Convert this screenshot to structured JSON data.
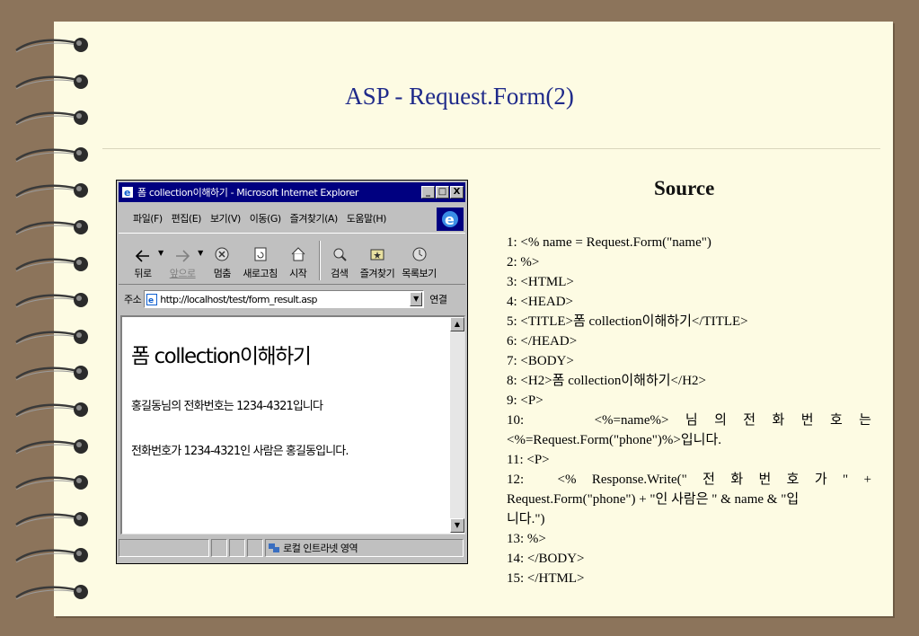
{
  "slide": {
    "title": "ASP - Request.Form(2)",
    "source_heading": "Source"
  },
  "browser": {
    "window_title": "폼 collection이해하기 - Microsoft Internet Explorer",
    "window_buttons": [
      "_",
      "□",
      "X"
    ],
    "menu": [
      "파일(F)",
      "편집(E)",
      "보기(V)",
      "이동(G)",
      "즐겨찾기(A)",
      "도움말(H)"
    ],
    "toolbar": {
      "back": "뒤로",
      "forward": "앞으로",
      "stop": "멈춤",
      "refresh": "새로고침",
      "home": "시작",
      "search": "검색",
      "favorites": "즐겨찾기",
      "history": "목록보기"
    },
    "address_label": "주소",
    "address_url": "http://localhost/test/form_result.asp",
    "go_label": "연결",
    "page": {
      "heading": "폼 collection이해하기",
      "line1": "홍길동님의 전화번호는 1234-4321입니다",
      "line2": "전화번호가 1234-4321인 사람은 홍길동입니다."
    },
    "status_zone": "로컬 인트라넷 영역"
  },
  "source_code": {
    "l1": "1:  <% name = Request.Form(\"name\")",
    "l2": "2:  %>",
    "l3": "3:  <HTML>",
    "l4": "4:  <HEAD>",
    "l5": "5:    <TITLE>폼 collection이해하기</TITLE>",
    "l6": "6:  </HEAD>",
    "l7": "7:  <BODY>",
    "l8": "8:    <H2>폼 collection이해하기</H2>",
    "l9": "9:    <P>",
    "l10_parts": [
      "10:",
      "<%=name%>",
      "님",
      "의",
      "전",
      "화",
      "번",
      "호",
      "는"
    ],
    "l10b": "<%=Request.Form(\"phone\")%>입니다.",
    "l11": "11:   <P>",
    "l12_parts": [
      "12:",
      "<%",
      "Response.Write(\"",
      "전",
      "화",
      "번",
      "호",
      "가",
      "\"",
      "+"
    ],
    "l12b": "Request.Form(\"phone\") + \"인 사람은 \" & name & \"입",
    "l12c": "니다.\")",
    "l13": "13:   %>",
    "l14": "14: </BODY>",
    "l15": "15: </HTML>"
  },
  "colors": {
    "background": "#8c745b",
    "page": "#fdfbe3",
    "title": "#1f2a8a",
    "titlebar": "#000080"
  }
}
